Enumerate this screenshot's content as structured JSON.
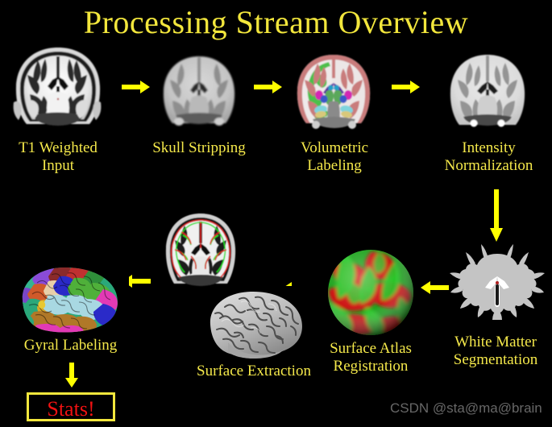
{
  "page": {
    "title": "Processing Stream Overview",
    "background_color": "#000000",
    "title_color": "#F2E63C",
    "label_color": "#F4E84A",
    "arrow_color": "#FFFF00",
    "stats_text_color": "#F21212",
    "watermark_color": "#8A8A8A"
  },
  "steps": [
    {
      "id": "t1-weighted-input",
      "label": "T1 Weighted\nInput",
      "image": "coronal-mri-with-skull",
      "row": 1,
      "order": 1
    },
    {
      "id": "skull-stripping",
      "label": "Skull Stripping",
      "image": "coronal-mri-brain-only",
      "row": 1,
      "order": 2
    },
    {
      "id": "volumetric-labeling",
      "label": "Volumetric Labeling",
      "image": "coronal-mri-colored-subcortical-labels",
      "row": 1,
      "order": 3
    },
    {
      "id": "intensity-normalization",
      "label": "Intensity\nNormalization",
      "image": "coronal-mri-normalized",
      "row": 1,
      "order": 4
    },
    {
      "id": "white-matter-segmentation",
      "label": "White Matter\nSegmentation",
      "image": "coronal-white-matter-mask",
      "row": 2,
      "order": 5
    },
    {
      "id": "surface-atlas-registration",
      "label": "Surface Atlas\nRegistration",
      "image": "inflated-sphere-red-green-curvature",
      "row": 2,
      "order": 6
    },
    {
      "id": "surface-extraction",
      "label": "Surface Extraction",
      "image": "gray-3d-pial-surface",
      "row": 2,
      "order": 7
    },
    {
      "id": "surface-contours",
      "label": "",
      "image": "coronal-mri-with-red-green-surface-contours",
      "row": 2,
      "order": 8
    },
    {
      "id": "gyral-labeling",
      "label": "Gyral Labeling",
      "image": "lateral-surface-colored-parcellation",
      "row": 2,
      "order": 9
    }
  ],
  "stats": {
    "label": "Stats!"
  },
  "watermark": {
    "text": "CSDN @sta@ma@brain"
  },
  "arrows": [
    {
      "id": "arrow-t1-to-skullstrip",
      "direction": "right"
    },
    {
      "id": "arrow-skullstrip-to-volumetric",
      "direction": "right"
    },
    {
      "id": "arrow-volumetric-to-intensity",
      "direction": "right"
    },
    {
      "id": "arrow-intensity-to-whitematter",
      "direction": "down"
    },
    {
      "id": "arrow-whitematter-to-atlas",
      "direction": "left"
    },
    {
      "id": "arrow-atlas-to-surface",
      "direction": "left"
    },
    {
      "id": "arrow-surface-to-gyral",
      "direction": "left"
    },
    {
      "id": "arrow-gyral-to-stats",
      "direction": "down"
    }
  ]
}
